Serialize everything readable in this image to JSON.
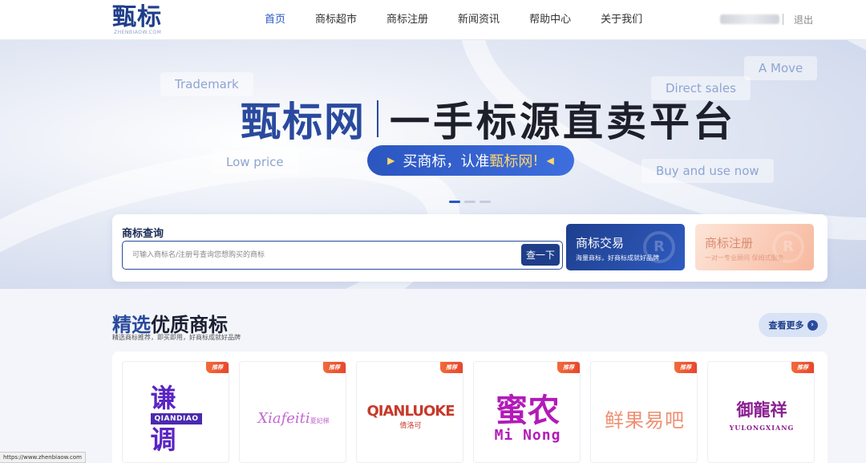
{
  "header": {
    "logo_cn": "甄标",
    "logo_en": "ZHENBIAOW.COM",
    "nav": [
      "首页",
      "商标超市",
      "商标注册",
      "新闻资讯",
      "帮助中心",
      "关于我们"
    ],
    "logout": "退出"
  },
  "banner": {
    "tags": [
      "Trademark",
      "Direct sales",
      "A Move",
      "Low price",
      "Buy and use now"
    ],
    "brand": "甄标网",
    "slogan": "一手标源直卖平台",
    "pill_text": "买商标，认准",
    "pill_highlight": "甄标网",
    "pill_end": "!"
  },
  "search": {
    "title": "商标查询",
    "placeholder": "可输入商标名/注册号查询您想购买的商标",
    "button": "查一下"
  },
  "cards": {
    "trade_title": "商标交易",
    "trade_sub": "海量商标，好商标成就好品牌",
    "reg_title": "商标注册",
    "reg_sub": "一对一专业顾问 保姆式服务"
  },
  "section": {
    "title_blue": "精选",
    "title_rest": "优质商标",
    "subtitle": "精选商标推荐，即买即用，好商标成就好品牌",
    "more": "查看更多"
  },
  "trademarks": [
    {
      "badge": "推荐",
      "line1": "谦",
      "en": "QIANDIAO",
      "line2": "调"
    },
    {
      "badge": "推荐",
      "name": "Xiafeiti",
      "cn": "夏妃梯"
    },
    {
      "badge": "推荐",
      "name": "QIANLUOKE",
      "cn": "倩洛可"
    },
    {
      "badge": "推荐",
      "name": "蜜农",
      "en": "Mi Nong"
    },
    {
      "badge": "推荐",
      "name": "鲜果易吧"
    },
    {
      "badge": "推荐",
      "name": "御龍祥",
      "en": "YULONGXIANG"
    }
  ],
  "status_url": "https://www.zhenbiaow.com",
  "colors": {
    "primary": "#2a4a9e",
    "accent": "#ffd76a",
    "badge": "#e8462c"
  }
}
